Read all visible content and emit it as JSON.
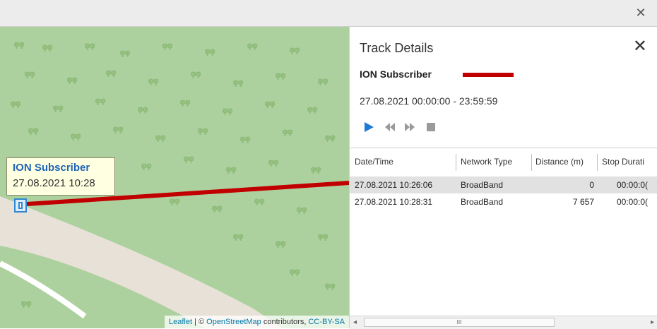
{
  "window": {
    "close_icon": "close-icon"
  },
  "map": {
    "popup_title": "ION Subscriber",
    "popup_datetime": "27.08.2021 10:28",
    "attribution": {
      "leaflet": "Leaflet",
      "sep": " | © ",
      "osm": "OpenStreetMap",
      "mid": " contributors, ",
      "license": "CC-BY-SA"
    },
    "track_color": "#c00000"
  },
  "panel": {
    "title": "Track Details",
    "subscriber": "ION Subscriber",
    "legend_color": "#c00000",
    "range": "27.08.2021 00:00:00 - 23:59:59",
    "controls": [
      "play-icon",
      "rewind-icon",
      "fast-forward-icon",
      "stop-icon"
    ],
    "table": {
      "columns": [
        "Date/Time",
        "Network Type",
        "Distance (m)",
        "Stop Durati"
      ],
      "rows": [
        [
          "27.08.2021 10:26:06",
          "BroadBand",
          "0",
          "00:00:0("
        ],
        [
          "27.08.2021 10:28:31",
          "BroadBand",
          "7 657",
          "00:00:0("
        ]
      ],
      "scroll_thumb": "III"
    }
  }
}
